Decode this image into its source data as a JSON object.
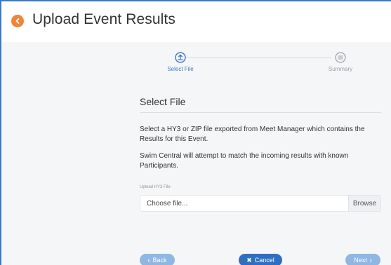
{
  "header": {
    "title": "Upload Event Results"
  },
  "stepper": {
    "steps": [
      {
        "label": "Select File",
        "state": "active"
      },
      {
        "label": "Summary",
        "state": "inactive"
      }
    ]
  },
  "section": {
    "title": "Select File",
    "paragraph_1": "Select a HY3 or ZIP file exported from Meet Manager which contains the Results for this Event.",
    "paragraph_2": "Swim Central will attempt to match the incoming results with known Participants."
  },
  "upload": {
    "label": "Upload HY3 File",
    "placeholder": "Choose file...",
    "browse_label": "Browse"
  },
  "footer": {
    "back_label": "Back",
    "cancel_label": "Cancel",
    "next_label": "Next"
  },
  "colors": {
    "accent": "#3b78c9",
    "header_icon": "#f0853a",
    "primary_button": "#2f6fc2",
    "disabled_button": "#8fb7e3"
  }
}
